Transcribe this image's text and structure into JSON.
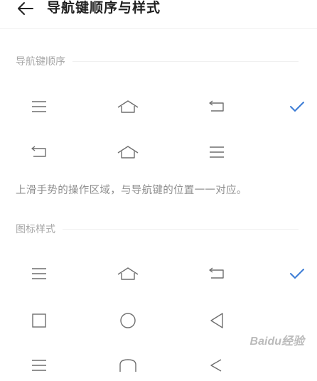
{
  "header": {
    "title": "导航键顺序与样式",
    "back_icon": "arrow-left-icon"
  },
  "sections": {
    "order": {
      "label": "导航键顺序",
      "rows": [
        {
          "icons": [
            "menu-icon",
            "home-icon",
            "back-icon"
          ],
          "selected": true
        },
        {
          "icons": [
            "back-icon",
            "home-icon",
            "menu-icon"
          ],
          "selected": false
        }
      ]
    },
    "hint": "上滑手势的操作区域，与导航键的位置一一对应。",
    "style": {
      "label": "图标样式",
      "rows": [
        {
          "icons": [
            "menu-icon",
            "home-icon",
            "back-icon"
          ],
          "selected": true
        },
        {
          "icons": [
            "square-icon",
            "circle-icon",
            "triangle-back-icon"
          ],
          "selected": false
        },
        {
          "icons": [
            "menu-icon",
            "rounded-home-icon",
            "chevron-back-icon"
          ],
          "selected": false
        }
      ]
    }
  },
  "watermark": "Baidu经验",
  "colors": {
    "accent": "#3a7bd5",
    "icon": "#6f6f6f",
    "label": "#a8a8a8",
    "hint": "#8f8f8f"
  }
}
